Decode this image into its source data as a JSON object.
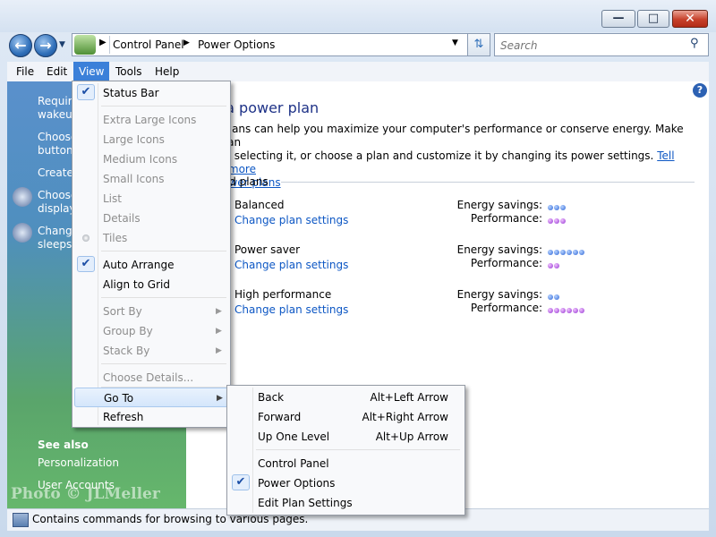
{
  "window": {
    "min_glyph": "—",
    "max_glyph": "□",
    "close_glyph": "✕"
  },
  "nav": {
    "back_glyph": "←",
    "forward_glyph": "→",
    "dropdown_glyph": "▼",
    "address": {
      "crumbs": [
        "Control Panel",
        "Power Options"
      ],
      "separator_glyph": "▶",
      "dropdown_glyph": "▼"
    },
    "refresh_glyph": "⇅",
    "search_placeholder": "Search",
    "search_glyph": "⚲"
  },
  "menubar": {
    "items": [
      "File",
      "Edit",
      "View",
      "Tools",
      "Help"
    ]
  },
  "taskpane": {
    "links": [
      "Require",
      "wakeup",
      "Choose",
      "buttons",
      "Create",
      "Choose",
      "display",
      "Change",
      "sleeps"
    ],
    "see_also_heading": "See also",
    "see_also_links": [
      "Personalization",
      "User Accounts"
    ],
    "watermark": "Photo © JLMeller"
  },
  "content": {
    "help_glyph": "?",
    "title": "ct a power plan",
    "desc_line1": "er plans can help you maximize your computer's performance or conserve energy. Make a plan",
    "desc_line2_prefix": "e by selecting it, or choose a plan and customize it by changing its power settings.",
    "desc_link1": "Tell me more",
    "desc_link2": "t power plans",
    "section_title": "erred plans",
    "energy_label": "Energy savings:",
    "performance_label": "Performance:",
    "plans": [
      {
        "name": "Balanced",
        "link": "Change plan settings",
        "energy_savings": 3,
        "performance": 3
      },
      {
        "name": "Power saver",
        "link": "Change plan settings",
        "energy_savings": 6,
        "performance": 2
      },
      {
        "name": "High performance",
        "link": "Change plan settings",
        "energy_savings": 2,
        "performance": 6
      }
    ],
    "colors": {
      "energy_dot": "#2d64d6",
      "performance_dot": "#9433d1",
      "title": "#1e3287",
      "link": "#0d57c4"
    }
  },
  "view_menu": {
    "check_glyph": "✔",
    "arrow_glyph": "▶",
    "items": {
      "status_bar": "Status Bar",
      "extra_large": "Extra Large Icons",
      "large": "Large Icons",
      "medium": "Medium Icons",
      "small": "Small Icons",
      "list": "List",
      "details": "Details",
      "tiles": "Tiles",
      "auto_arrange": "Auto Arrange",
      "align_grid": "Align to Grid",
      "sort_by": "Sort By",
      "group_by": "Group By",
      "stack_by": "Stack By",
      "choose_details": "Choose Details...",
      "go_to": "Go To",
      "refresh": "Refresh"
    }
  },
  "goto_menu": {
    "check_glyph": "✔",
    "items": [
      {
        "label": "Back",
        "shortcut": "Alt+Left Arrow"
      },
      {
        "label": "Forward",
        "shortcut": "Alt+Right Arrow"
      },
      {
        "label": "Up One Level",
        "shortcut": "Alt+Up Arrow"
      },
      {
        "label": "Control Panel",
        "shortcut": ""
      },
      {
        "label": "Power Options",
        "shortcut": ""
      },
      {
        "label": "Edit Plan Settings",
        "shortcut": ""
      }
    ]
  },
  "statusbar": {
    "text": "Contains commands for browsing to various pages."
  }
}
